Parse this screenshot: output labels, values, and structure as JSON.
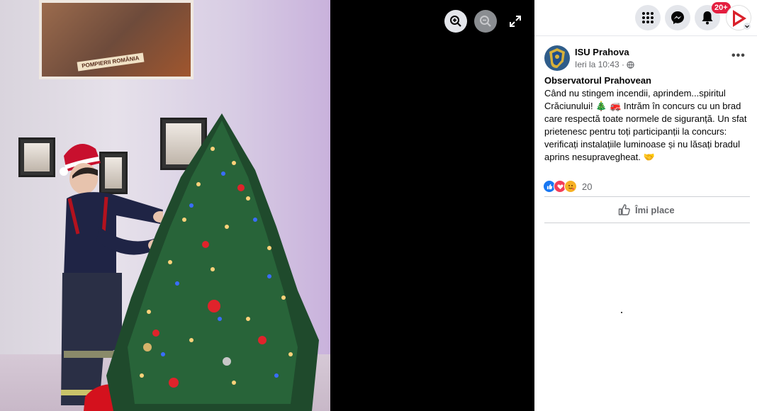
{
  "viewer": {
    "poster_caption": "POMPIERII ROMÂNIA",
    "zoom_in_icon": "zoom-in-icon",
    "zoom_out_icon": "zoom-out-icon",
    "fullscreen_icon": "expand-icon"
  },
  "topbar": {
    "menu_icon": "grid-icon",
    "messenger_icon": "messenger-icon",
    "notifications_icon": "bell-icon",
    "notifications_badge": "20+"
  },
  "post": {
    "author": "ISU Prahova",
    "time": "Ieri la 10:43 ·",
    "headline": "Observatorul Prahovean",
    "body": "Când nu stingem incendii, aprindem...spiritul Crăciunului! 🎄 🚒 Intrăm în concurs cu un brad care respectă toate normele de siguranță. Un sfat prietenesc pentru toți participanții la concurs: verificați instalațiile luminoase și nu lăsați bradul aprins nesupravegheat. 🤝",
    "reaction_count": "20",
    "like_label": "Îmi place"
  },
  "colors": {
    "accent": "#1877f2",
    "badge": "#e41e3f",
    "love": "#f33e58",
    "haha": "#f7b125"
  }
}
